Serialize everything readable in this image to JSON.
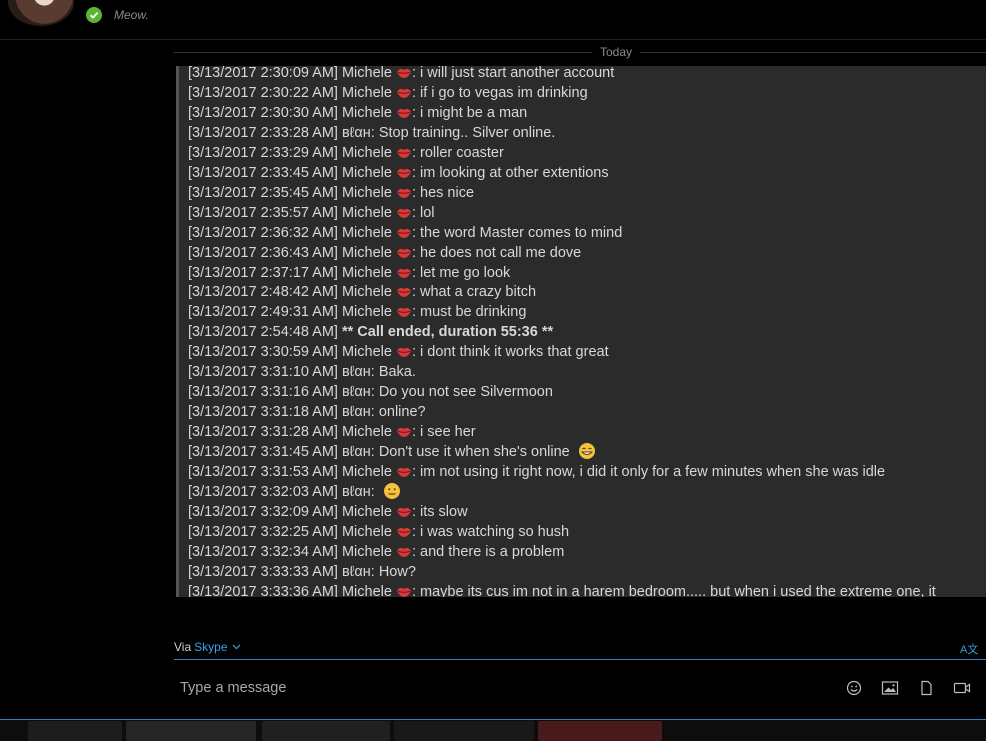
{
  "header": {
    "mood": "Meow."
  },
  "divider": {
    "label": "Today"
  },
  "messages": [
    {
      "t": "[3/13/2017 2:30:09 AM] Michele",
      "lips": true,
      "m": ": i will just start another account"
    },
    {
      "t": "[3/13/2017 2:30:22 AM] Michele",
      "lips": true,
      "m": ": if i go to vegas im drinking"
    },
    {
      "t": "[3/13/2017 2:30:30 AM] Michele",
      "lips": true,
      "m": ": i might be a man"
    },
    {
      "t": "[3/13/2017 2:33:28 AM] вℓαн: Stop training.. Silver online.",
      "lips": false,
      "m": ""
    },
    {
      "t": "[3/13/2017 2:33:29 AM] Michele",
      "lips": true,
      "m": ": roller coaster"
    },
    {
      "t": "[3/13/2017 2:33:45 AM] Michele",
      "lips": true,
      "m": ": im looking at other extentions"
    },
    {
      "t": "[3/13/2017 2:35:45 AM] Michele",
      "lips": true,
      "m": ": hes nice"
    },
    {
      "t": "[3/13/2017 2:35:57 AM] Michele",
      "lips": true,
      "m": ": lol"
    },
    {
      "t": "[3/13/2017 2:36:32 AM] Michele",
      "lips": true,
      "m": ": the word Master comes to mind"
    },
    {
      "t": "[3/13/2017 2:36:43 AM] Michele",
      "lips": true,
      "m": ": he does not call me dove"
    },
    {
      "t": "[3/13/2017 2:37:17 AM] Michele",
      "lips": true,
      "m": ": let me go look"
    },
    {
      "t": "[3/13/2017 2:48:42 AM] Michele",
      "lips": true,
      "m": ": what a crazy bitch"
    },
    {
      "t": "[3/13/2017 2:49:31 AM] Michele",
      "lips": true,
      "m": ": must be drinking"
    },
    {
      "t": "[3/13/2017 2:54:48 AM] ",
      "lips": false,
      "m": "",
      "b": "** Call ended, duration 55:36 **"
    },
    {
      "t": "[3/13/2017 3:30:59 AM] Michele",
      "lips": true,
      "m": ": i dont think it works that great"
    },
    {
      "t": "[3/13/2017 3:31:10 AM] вℓαн: Baka.",
      "lips": false,
      "m": ""
    },
    {
      "t": "[3/13/2017 3:31:16 AM] вℓαн: Do you not see Silvermoon",
      "lips": false,
      "m": ""
    },
    {
      "t": "[3/13/2017 3:31:18 AM] вℓαн: online?",
      "lips": false,
      "m": ""
    },
    {
      "t": "[3/13/2017 3:31:28 AM] Michele",
      "lips": true,
      "m": ": i see her"
    },
    {
      "t": "[3/13/2017 3:31:45 AM] вℓαн: Don't use it when she's online",
      "lips": false,
      "m": "",
      "emoji": "grin"
    },
    {
      "t": "[3/13/2017 3:31:53 AM] Michele",
      "lips": true,
      "m": ": im not using it right now, i did it only for a few minutes when she was idle"
    },
    {
      "t": "[3/13/2017 3:32:03 AM] вℓαн:",
      "lips": false,
      "m": "",
      "emoji": "neutral"
    },
    {
      "t": "[3/13/2017 3:32:09 AM] Michele",
      "lips": true,
      "m": ": its slow"
    },
    {
      "t": "[3/13/2017 3:32:25 AM] Michele",
      "lips": true,
      "m": ": i was watching so hush"
    },
    {
      "t": "[3/13/2017 3:32:34 AM] Michele",
      "lips": true,
      "m": ": and there is a problem"
    },
    {
      "t": "[3/13/2017 3:33:33 AM] вℓαн: How?",
      "lips": false,
      "m": ""
    },
    {
      "t": "[3/13/2017 3:33:36 AM] Michele",
      "lips": true,
      "m": ": maybe its cus im not in a harem bedroom..... but when i used the extreme one, it"
    }
  ],
  "compose": {
    "via_label": "Via",
    "via_service": "Skype",
    "translate_label": "A文",
    "placeholder": "Type a message"
  },
  "colors": {
    "accent": "#36a3e6",
    "status_online": "#5ab535",
    "quote_bg": "#2b2b2b"
  },
  "icons": [
    "check-icon",
    "lips-icon",
    "grin-emoji-icon",
    "neutral-emoji-icon",
    "chevron-down-icon",
    "translate-icon",
    "emoticon-icon",
    "image-icon",
    "file-icon",
    "video-message-icon"
  ]
}
